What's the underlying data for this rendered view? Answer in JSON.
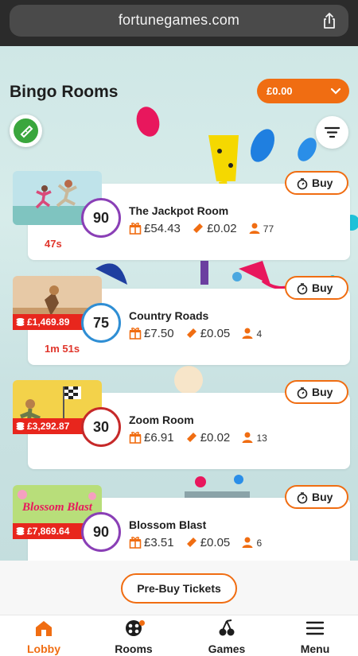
{
  "browser": {
    "url": "fortunegames.com"
  },
  "header": {
    "title": "Bingo Rooms",
    "balance": "£0.00"
  },
  "rooms": [
    {
      "name": "The Jackpot Room",
      "ball": "90",
      "prize": "£54.43",
      "ticket_price": "£0.02",
      "players": "77",
      "countdown": "47s",
      "jackpot": "",
      "buy_label": "Buy",
      "ball_color": "#8a3fb6"
    },
    {
      "name": "Country Roads",
      "ball": "75",
      "prize": "£7.50",
      "ticket_price": "£0.05",
      "players": "4",
      "countdown": "1m 51s",
      "jackpot": "£1,469.89",
      "buy_label": "Buy",
      "ball_color": "#2f8ed4"
    },
    {
      "name": "Zoom Room",
      "ball": "30",
      "prize": "£6.91",
      "ticket_price": "£0.02",
      "players": "13",
      "countdown": "",
      "jackpot": "£3,292.87",
      "buy_label": "Buy",
      "ball_color": "#c62929"
    },
    {
      "name": "Blossom Blast",
      "ball": "90",
      "prize": "£3.51",
      "ticket_price": "£0.05",
      "players": "6",
      "countdown": "",
      "jackpot": "£7,869.64",
      "buy_label": "Buy",
      "ball_color": "#8a3fb6",
      "thumb_text": "Blossom Blast"
    }
  ],
  "prebuy": {
    "label": "Pre-Buy Tickets"
  },
  "nav": [
    {
      "label": "Lobby",
      "icon": "house-icon"
    },
    {
      "label": "Rooms",
      "icon": "bingo-ball-icon"
    },
    {
      "label": "Games",
      "icon": "cherries-icon"
    },
    {
      "label": "Menu",
      "icon": "hamburger-icon"
    }
  ],
  "colors": {
    "accent": "#f06d12",
    "jackpot_tag": "#e8261d",
    "countdown": "#e0352b",
    "fab_green": "#3aa63d"
  }
}
